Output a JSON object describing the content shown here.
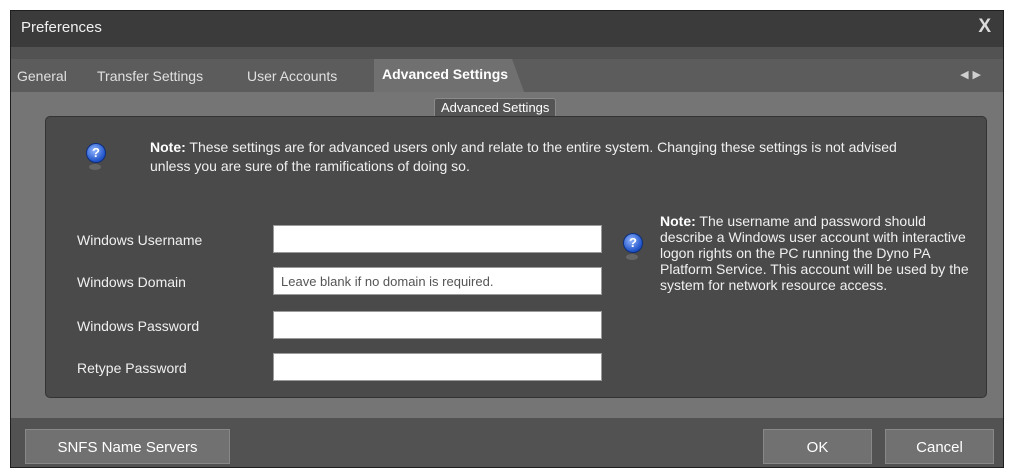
{
  "window": {
    "title": "Preferences",
    "close_label": "X"
  },
  "tabs": [
    {
      "label": "General",
      "active": false
    },
    {
      "label": "Transfer Settings",
      "active": false
    },
    {
      "label": "User Accounts",
      "active": false
    },
    {
      "label": "Advanced Settings",
      "active": true
    }
  ],
  "tab_scroll": {
    "left": "◀",
    "right": "▶"
  },
  "group": {
    "title": "Advanced Settings",
    "note_bold": "Note:",
    "note_text": " These settings are for advanced users only and relate to the entire system. Changing these settings is not advised unless you are sure of the ramifications of doing so."
  },
  "fields": [
    {
      "label": "Windows Username",
      "value": "",
      "placeholder": ""
    },
    {
      "label": "Windows Domain",
      "value": "",
      "placeholder": "Leave blank if no domain is required."
    },
    {
      "label": "Windows Password",
      "value": "",
      "placeholder": ""
    },
    {
      "label": "Retype Password",
      "value": "",
      "placeholder": ""
    }
  ],
  "side_note": {
    "bold": "Note:",
    "text": " The username and password should describe a Windows user account with interactive logon rights on the PC running the Dyno PA Platform Service. This account will be used by the system for network resource access."
  },
  "footer": {
    "name_servers_label": "SNFS Name Servers",
    "ok_label": "OK",
    "cancel_label": "Cancel"
  },
  "icons": {
    "help": "help-icon",
    "close": "close-icon"
  },
  "colors": {
    "window_bg": "#525252",
    "groupbox_bg": "#4a4a4a",
    "help_blue": "#1f52c8"
  }
}
